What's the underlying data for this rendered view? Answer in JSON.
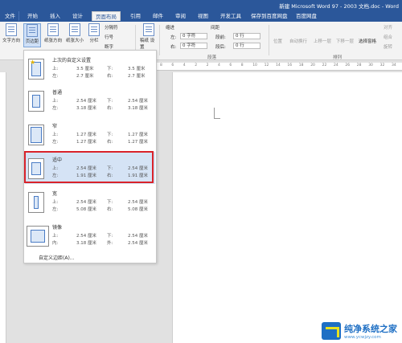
{
  "window": {
    "title": "新建 Microsoft Word 97 - 2003 文档.doc - Word"
  },
  "tabs": [
    "文件",
    "开始",
    "插入",
    "设计",
    "页面布局",
    "引用",
    "邮件",
    "审阅",
    "视图",
    "开发工具",
    "保存到百度网盘",
    "百度网盘"
  ],
  "active_tab": "页面布局",
  "ribbon": {
    "text_direction": "文字方向",
    "margins": "页边距",
    "orientation": "纸张方向",
    "size": "纸张大小",
    "columns": "分栏",
    "breaks": "分隔符",
    "line_numbers": "行号",
    "hyphenation": "断字",
    "draft_settings": "稿纸\n设置",
    "indent": "缩进",
    "spacing": "间距",
    "indent_left_label": "左:",
    "indent_left_value": "0 字符",
    "indent_right_label": "右:",
    "indent_right_value": "0 字符",
    "spacing_before_label": "段前:",
    "spacing_before_value": "0 行",
    "spacing_after_label": "段后:",
    "spacing_after_value": "0 行",
    "paragraph_group": "段落",
    "position": "位置",
    "wrap_text": "自动换行",
    "bring_forward": "上移一层",
    "send_backward": "下移一层",
    "selection_pane": "选择窗格",
    "arrange_group": "排列",
    "align": "对齐",
    "group": "组合",
    "rotate": "旋转"
  },
  "ruler_ticks": [
    "8",
    "6",
    "4",
    "2",
    "2",
    "4",
    "6",
    "8",
    "10",
    "12",
    "14",
    "16",
    "18",
    "20",
    "22",
    "24",
    "26",
    "28",
    "30",
    "32",
    "34"
  ],
  "margins_menu": {
    "options": [
      {
        "name": "上次的自定义设置",
        "top_label": "上:",
        "top": "3.5 厘米",
        "bottom_label": "下:",
        "bottom": "3.5 厘米",
        "left_label": "左:",
        "left": "2.7 厘米",
        "right_label": "右:",
        "right": "2.7 厘米"
      },
      {
        "name": "普通",
        "top_label": "上:",
        "top": "2.54 厘米",
        "bottom_label": "下:",
        "bottom": "2.54 厘米",
        "left_label": "左:",
        "left": "3.18 厘米",
        "right_label": "右:",
        "right": "3.18 厘米"
      },
      {
        "name": "窄",
        "top_label": "上:",
        "top": "1.27 厘米",
        "bottom_label": "下:",
        "bottom": "1.27 厘米",
        "left_label": "左:",
        "left": "1.27 厘米",
        "right_label": "右:",
        "right": "1.27 厘米"
      },
      {
        "name": "适中",
        "top_label": "上:",
        "top": "2.54 厘米",
        "bottom_label": "下:",
        "bottom": "2.54 厘米",
        "left_label": "左:",
        "left": "1.91 厘米",
        "right_label": "右:",
        "right": "1.91 厘米"
      },
      {
        "name": "宽",
        "top_label": "上:",
        "top": "2.54 厘米",
        "bottom_label": "下:",
        "bottom": "2.54 厘米",
        "left_label": "左:",
        "left": "5.08 厘米",
        "right_label": "右:",
        "right": "5.08 厘米"
      },
      {
        "name": "镜像",
        "top_label": "上:",
        "top": "2.54 厘米",
        "bottom_label": "下:",
        "bottom": "2.54 厘米",
        "left_label": "内:",
        "left": "3.18 厘米",
        "right_label": "外:",
        "right": "2.54 厘米"
      }
    ],
    "custom": "自定义边距(A)..."
  },
  "watermark": {
    "title": "纯净系统之家",
    "url": "www.ycwjzy.com"
  },
  "colors": {
    "accent": "#2b579a",
    "highlight": "#d9232a"
  }
}
